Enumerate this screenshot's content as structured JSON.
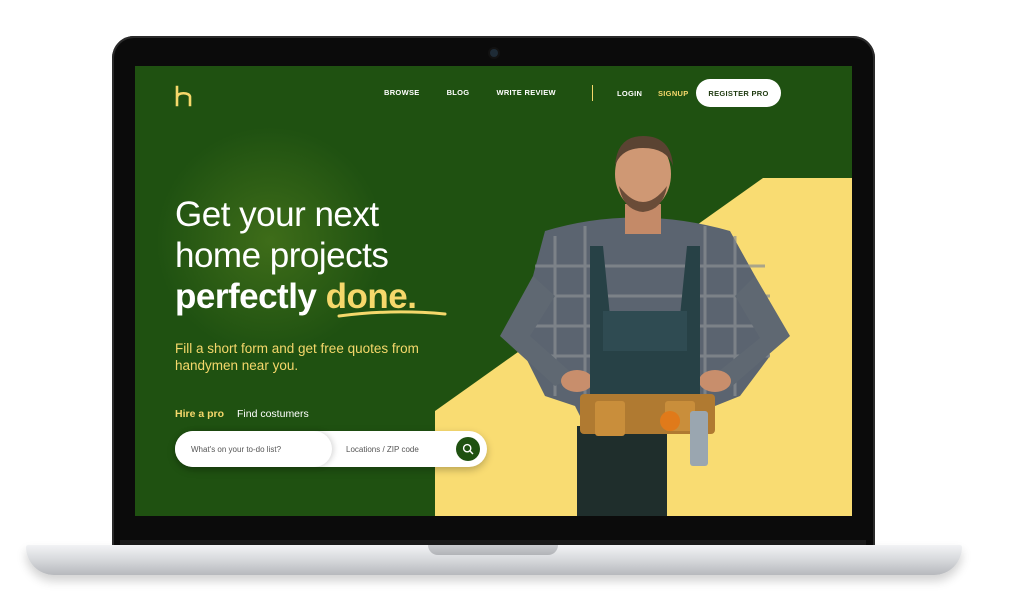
{
  "nav": {
    "links": [
      "BROWSE",
      "BLOG",
      "WRITE REVIEW"
    ],
    "login": "LOGIN",
    "signup": "SIGNUP",
    "register": "REGISTER PRO"
  },
  "hero": {
    "line1": "Get your next",
    "line2": "home projects",
    "line3_prefix": "perfectly ",
    "line3_accent": "done.",
    "subtitle": "Fill a short form and get free quotes from handymen near you."
  },
  "tabs": {
    "hire": "Hire a pro",
    "find": "Find costumers"
  },
  "search": {
    "todo_placeholder": "What's on your to-do list?",
    "location_placeholder": "Locations / ZIP code"
  },
  "colors": {
    "brand_green": "#1f5111",
    "accent_yellow": "#f5d86b"
  },
  "icons": {
    "logo": "h-logo-icon",
    "search": "search-icon"
  }
}
